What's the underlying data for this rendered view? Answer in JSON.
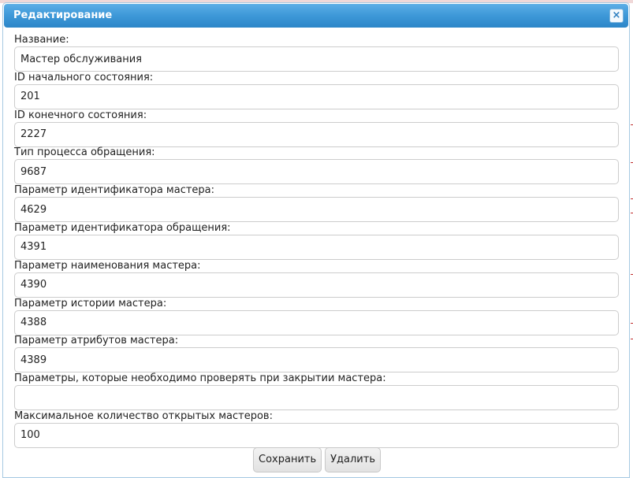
{
  "dialog": {
    "title": "Редактирование",
    "close_icon": "×"
  },
  "fields": [
    {
      "label": "Название:",
      "value": "Мастер обслуживания"
    },
    {
      "label": "ID начального состояния:",
      "value": "201"
    },
    {
      "label": "ID конечного состояния:",
      "value": "2227"
    },
    {
      "label": "Тип процесса обращения:",
      "value": "9687"
    },
    {
      "label": "Параметр идентификатора мастера:",
      "value": "4629"
    },
    {
      "label": "Параметр идентификатора обращения:",
      "value": "4391"
    },
    {
      "label": "Параметр наименования мастера:",
      "value": "4390"
    },
    {
      "label": "Параметр истории мастера:",
      "value": "4388"
    },
    {
      "label": "Параметр атрибутов мастера:",
      "value": "4389"
    },
    {
      "label": "Параметры, которые необходимо проверять при закрытии мастера:",
      "value": ""
    },
    {
      "label": "Максимальное количество открытых мастеров:",
      "value": "100"
    }
  ],
  "actions": {
    "save_label": "Сохранить",
    "delete_label": "Удалить"
  },
  "colors": {
    "titlebar": "#3d98d8",
    "title_text": "#ffffff",
    "input_border": "#cccccc"
  }
}
